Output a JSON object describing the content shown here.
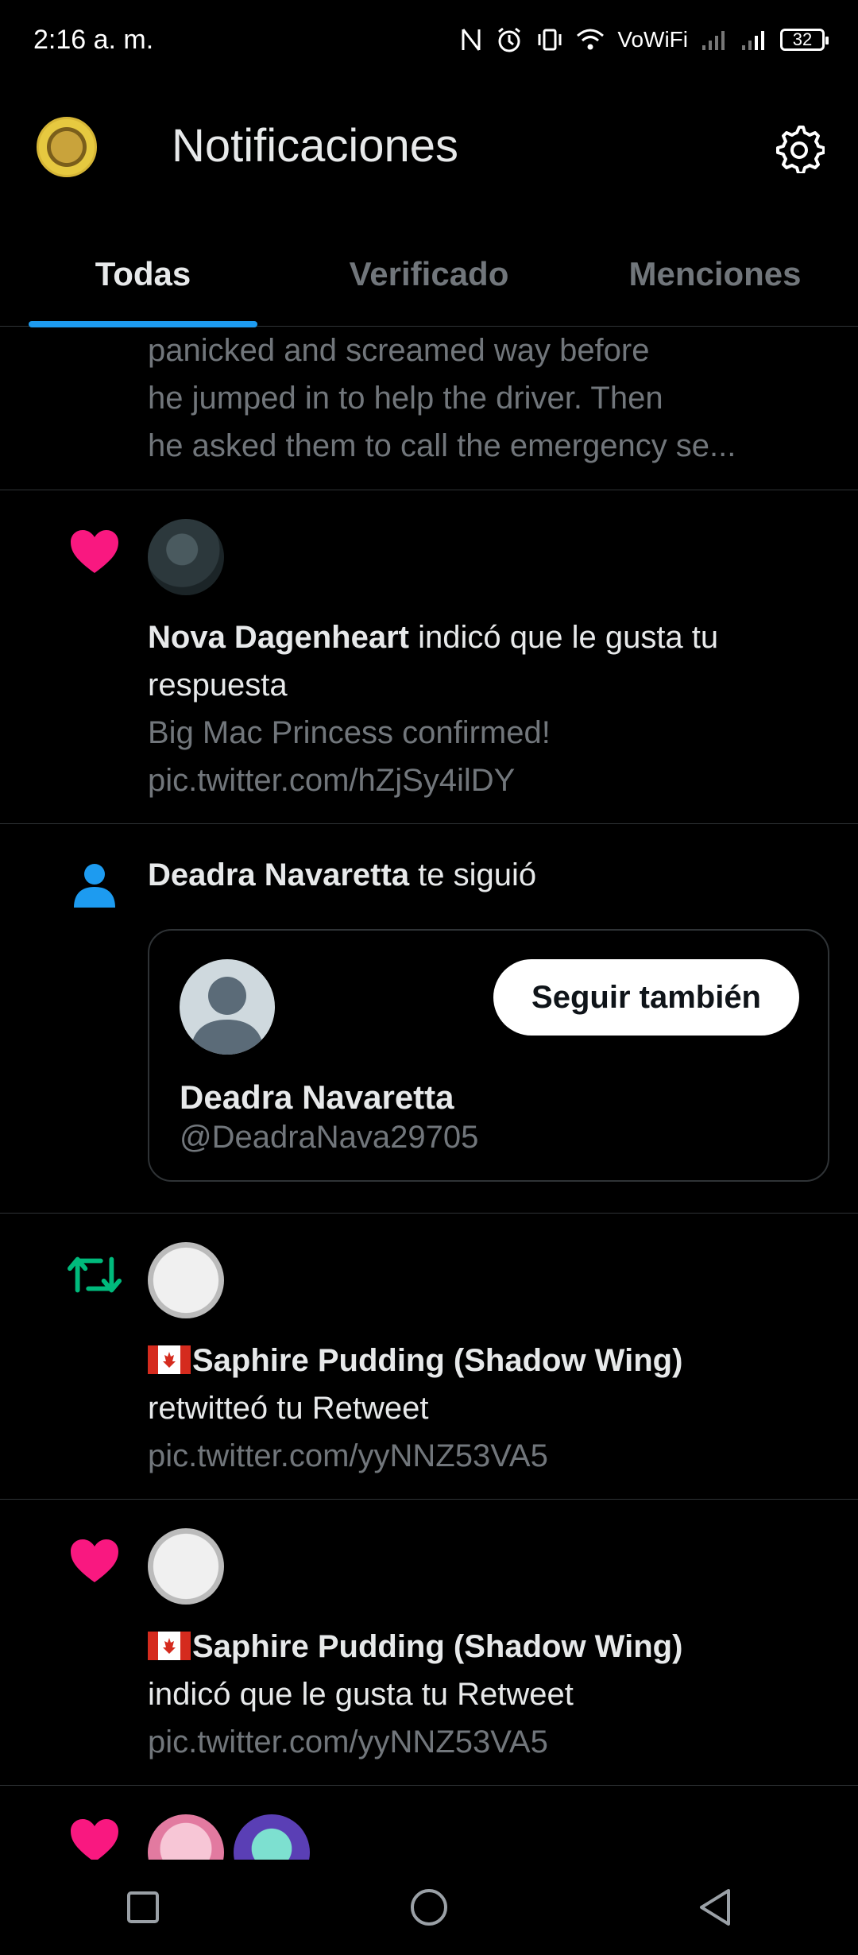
{
  "status_bar": {
    "time": "2:16 a. m.",
    "wifi_label": "VoWiFi",
    "battery": "32"
  },
  "header": {
    "title": "Notificaciones"
  },
  "tabs": [
    {
      "label": "Todas",
      "active": true
    },
    {
      "label": "Verificado",
      "active": false
    },
    {
      "label": "Menciones",
      "active": false
    }
  ],
  "feed": {
    "partial_item": {
      "lines": [
        "panicked and screamed way before",
        "he jumped in to help the driver. Then",
        "he asked them to call the emergency se..."
      ]
    },
    "like_item_1": {
      "icon": "heart-icon",
      "user": "Nova Dagenheart",
      "action_line1": " indicó que le gusta tu",
      "action_line2": "respuesta",
      "snippet_line1": "Big Mac Princess confirmed!",
      "snippet_line2": "pic.twitter.com/hZjSy4ilDY"
    },
    "follow_item": {
      "icon": "person-icon",
      "user": "Deadra Navaretta",
      "action": " te siguió",
      "card_name": "Deadra Navaretta",
      "card_handle": "@DeadraNava29705",
      "follow_button": "Seguir también"
    },
    "retweet_item": {
      "icon": "retweet-icon",
      "user": "Saphire Pudding (Shadow Wing)",
      "action": "retwitteó tu Retweet",
      "link": "pic.twitter.com/yyNNZ53VA5"
    },
    "like_item_2": {
      "icon": "heart-icon",
      "user": "Saphire Pudding (Shadow Wing)",
      "action": "indicó que le gusta tu Retweet",
      "link": "pic.twitter.com/yyNNZ53VA5"
    }
  },
  "colors": {
    "accent": "#1d9bf0",
    "like": "#f91880",
    "retweet": "#00ba7c",
    "muted": "#71767b",
    "divider": "#2f3336"
  }
}
